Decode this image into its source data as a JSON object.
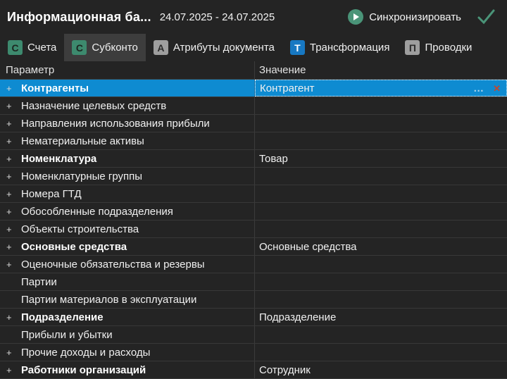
{
  "header": {
    "title": "Информационная ба...",
    "date_range": "24.07.2025 - 24.07.2025",
    "sync_label": "Синхронизировать"
  },
  "icons": {
    "play": "play-icon",
    "check": "check-icon",
    "expand_glyph": "+",
    "ellipsis_glyph": "…",
    "clear_glyph": "✕"
  },
  "colors": {
    "background": "#242424",
    "selection_blue": "#0e8bd1",
    "accent_green": "#4a9478",
    "icon_green": "#3d8a6e",
    "icon_blue": "#1778c2",
    "icon_gray": "#9e9e9e",
    "clear_red": "#c2472e",
    "tab_selected_bg": "#3d3d3d",
    "divider": "#3b3b3b"
  },
  "tabs": [
    {
      "id": "accounts",
      "letter": "С",
      "label": "Счета",
      "icon_color": "green",
      "selected": false
    },
    {
      "id": "subconto",
      "letter": "С",
      "label": "Субконто",
      "icon_color": "green",
      "selected": true
    },
    {
      "id": "doc-attributes",
      "letter": "А",
      "label": "Атрибуты документа",
      "icon_color": "gray",
      "selected": false
    },
    {
      "id": "transformation",
      "letter": "Т",
      "label": "Трансформация",
      "icon_color": "blue",
      "selected": false
    },
    {
      "id": "postings",
      "letter": "П",
      "label": "Проводки",
      "icon_color": "gray",
      "selected": false
    }
  ],
  "table": {
    "columns": [
      "Параметр",
      "Значение"
    ],
    "rows": [
      {
        "expandable": true,
        "param": "Контрагенты",
        "value": "Контрагент",
        "bold": true,
        "selected": true,
        "editing": true
      },
      {
        "expandable": true,
        "param": "Назначение целевых средств",
        "value": "",
        "bold": false,
        "selected": false,
        "editing": false
      },
      {
        "expandable": true,
        "param": "Направления использования прибыли",
        "value": "",
        "bold": false,
        "selected": false,
        "editing": false
      },
      {
        "expandable": true,
        "param": "Нематериальные активы",
        "value": "",
        "bold": false,
        "selected": false,
        "editing": false
      },
      {
        "expandable": true,
        "param": "Номенклатура",
        "value": "Товар",
        "bold": true,
        "selected": false,
        "editing": false
      },
      {
        "expandable": true,
        "param": "Номенклатурные группы",
        "value": "",
        "bold": false,
        "selected": false,
        "editing": false
      },
      {
        "expandable": true,
        "param": "Номера ГТД",
        "value": "",
        "bold": false,
        "selected": false,
        "editing": false
      },
      {
        "expandable": true,
        "param": "Обособленные подразделения",
        "value": "",
        "bold": false,
        "selected": false,
        "editing": false
      },
      {
        "expandable": true,
        "param": "Объекты строительства",
        "value": "",
        "bold": false,
        "selected": false,
        "editing": false
      },
      {
        "expandable": true,
        "param": "Основные средства",
        "value": "Основные средства",
        "bold": true,
        "selected": false,
        "editing": false
      },
      {
        "expandable": true,
        "param": "Оценочные обязательства и резервы",
        "value": "",
        "bold": false,
        "selected": false,
        "editing": false
      },
      {
        "expandable": false,
        "param": "Партии",
        "value": "",
        "bold": false,
        "selected": false,
        "editing": false
      },
      {
        "expandable": false,
        "param": "Партии материалов в эксплуатации",
        "value": "",
        "bold": false,
        "selected": false,
        "editing": false
      },
      {
        "expandable": true,
        "param": "Подразделение",
        "value": "Подразделение",
        "bold": true,
        "selected": false,
        "editing": false
      },
      {
        "expandable": false,
        "param": "Прибыли и убытки",
        "value": "",
        "bold": false,
        "selected": false,
        "editing": false
      },
      {
        "expandable": true,
        "param": "Прочие доходы и расходы",
        "value": "",
        "bold": false,
        "selected": false,
        "editing": false
      },
      {
        "expandable": true,
        "param": "Работники организаций",
        "value": "Сотрудник",
        "bold": true,
        "selected": false,
        "editing": false
      }
    ]
  }
}
